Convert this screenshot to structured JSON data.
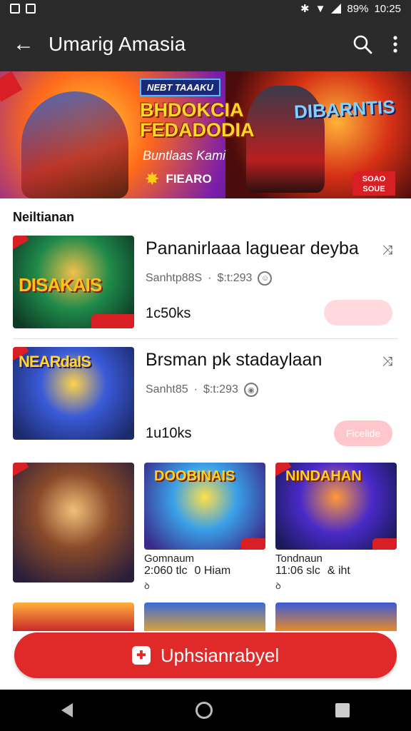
{
  "status_bar": {
    "battery": "89%",
    "time": "10:25"
  },
  "app_bar": {
    "back_glyph": "←",
    "title": "Umarig Amasia"
  },
  "banner": {
    "tag": "NEBT TAAAKU",
    "headline": "BHDOKCIA FEDADODIA",
    "subtitle": "Buntlaas Kami",
    "cta": "FIEARO",
    "logo_text": "DIBARNTIS",
    "badge_text": "SOAO SOUE"
  },
  "section": {
    "title": "Neiltianan"
  },
  "featured": [
    {
      "title": "Pananirlaaa laguear deyba",
      "meta_left": "Sanhtp88S",
      "meta_right": "$:t:293",
      "count": "1c50ks",
      "action": "",
      "thumb_text": "DISAKAIS"
    },
    {
      "title": "Brsman pk stadaylaan",
      "meta_left": "Sanht85",
      "meta_right": "$:t:293",
      "count": "1u10ks",
      "action": "Ficelide",
      "thumb_text": "NEARdaIS"
    }
  ],
  "grid": [
    {
      "thumb_text": "",
      "label": "",
      "stat1": "",
      "stat2": "",
      "dl": ""
    },
    {
      "thumb_text": "DOOBINAIS",
      "label": "Gomnaum",
      "stat1": "2:060 tlc",
      "stat2": "0 Hiam",
      "dl": "ꝺ"
    },
    {
      "thumb_text": "NINDAHAN",
      "label": "Tondnaun",
      "stat1": "11:06 slc",
      "stat2": "& iht",
      "dl": "ꝺ"
    }
  ],
  "cta": {
    "label": "Uphsianrabyel"
  },
  "colors": {
    "accent": "#e02a2a",
    "app_bar": "#2b2b2b",
    "action_pill": "#ffd9dd"
  },
  "icons": {
    "status_left": [
      "image-icon",
      "gallery-icon"
    ],
    "status_right": [
      "bluetooth-icon",
      "wifi-icon",
      "signal-icon"
    ],
    "app_bar": [
      "back-arrow-icon",
      "search-icon",
      "more-vert-icon"
    ],
    "nav": [
      "nav-back-icon",
      "nav-home-icon",
      "nav-recent-icon"
    ]
  }
}
